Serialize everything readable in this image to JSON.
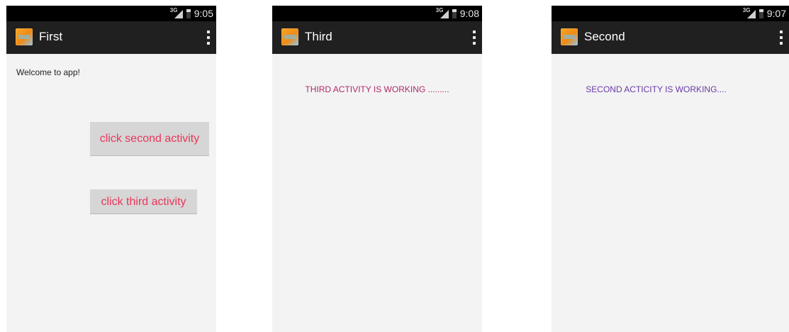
{
  "screens": [
    {
      "id": "first",
      "status_time": "9:05",
      "title": "First",
      "welcome_text": "Welcome to app!",
      "buttons": [
        {
          "label": "click second activity"
        },
        {
          "label": "click third activity"
        }
      ]
    },
    {
      "id": "third",
      "status_time": "9:08",
      "title": "Third",
      "message": "THIRD ACTIVITY IS WORKING ........."
    },
    {
      "id": "second",
      "status_time": "9:07",
      "title": "Second",
      "message": "SECOND ACTICITY IS WORKING...."
    }
  ],
  "status_bar": {
    "network_label": "3G",
    "icons": [
      "signal-icon",
      "battery-icon"
    ]
  },
  "action_bar": {
    "icons": [
      "app-icon",
      "overflow-menu-icon"
    ]
  },
  "colors": {
    "button_text": "#e8365a",
    "third_message": "#b02a6a",
    "second_message": "#6a3aa8",
    "action_bar": "#202020",
    "background": "#f3f3f3"
  }
}
